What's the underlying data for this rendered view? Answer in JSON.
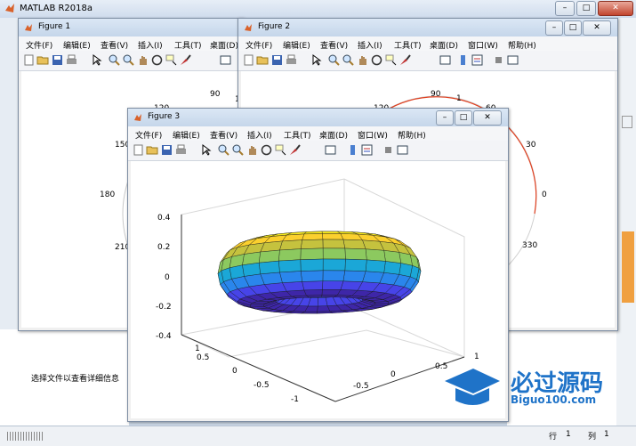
{
  "app": {
    "title": "MATLAB R2018a"
  },
  "main": {
    "info_text": "选择文件以查看详细信息",
    "status_row_label": "行",
    "status_row": "1",
    "status_col_label": "列",
    "status_col": "1"
  },
  "figures": {
    "fig1": {
      "title": "Figure 1",
      "menu": [
        "文件(F)",
        "编辑(E)",
        "查看(V)",
        "插入(I)",
        "工具(T)",
        "桌面(D)"
      ],
      "polar_labels": {
        "a90": "90",
        "a120": "120",
        "a150": "150",
        "a180": "180",
        "a210": "210",
        "r1": "1"
      }
    },
    "fig2": {
      "title": "Figure 2",
      "menu": [
        "文件(F)",
        "编辑(E)",
        "查看(V)",
        "插入(I)",
        "工具(T)",
        "桌面(D)",
        "窗口(W)",
        "帮助(H)"
      ],
      "polar_labels": {
        "a90": "90",
        "a60": "60",
        "a120": "120",
        "a30": "30",
        "a0": "0",
        "a330": "330",
        "r1": "1"
      }
    },
    "fig3": {
      "title": "Figure 3",
      "menu": [
        "文件(F)",
        "编辑(E)",
        "查看(V)",
        "插入(I)",
        "工具(T)",
        "桌面(D)",
        "窗口(W)",
        "帮助(H)"
      ]
    }
  },
  "chart_data": {
    "type": "surface",
    "shape": "torus",
    "colormap": "parula",
    "z_ticks": [
      "0.4",
      "0.2",
      "0",
      "-0.2",
      "-0.4"
    ],
    "x_ticks": [
      "1",
      "0.5",
      "0",
      "-0.5",
      "-1"
    ],
    "y_ticks": [
      "-1",
      "-0.5",
      "0",
      "0.5",
      "1"
    ],
    "zlim": [
      -0.4,
      0.4
    ],
    "xlim": [
      -1,
      1
    ],
    "ylim": [
      -1,
      1
    ],
    "grid": true
  },
  "watermark": {
    "text": "必过源码",
    "url_text": "Biguo100.com"
  }
}
